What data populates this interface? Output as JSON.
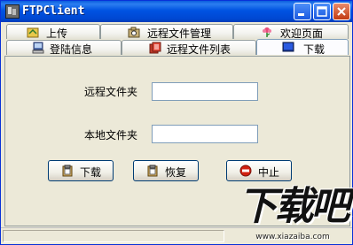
{
  "window": {
    "title": "FTPClient"
  },
  "tabs_top": [
    {
      "label": "上传",
      "icon": "upload-folder-icon"
    },
    {
      "label": "远程文件管理",
      "icon": "camera-icon"
    },
    {
      "label": "欢迎页面",
      "icon": "flower-icon"
    }
  ],
  "tabs_bottom": [
    {
      "label": "登陆信息",
      "icon": "computer-icon"
    },
    {
      "label": "远程文件列表",
      "icon": "folder-list-icon"
    },
    {
      "label": "下载",
      "icon": "monitor-icon",
      "active": true
    }
  ],
  "form": {
    "remote_folder_label": "远程文件夹",
    "remote_folder_value": "",
    "local_folder_label": "本地文件夹",
    "local_folder_value": ""
  },
  "actions": {
    "download_label": "下载",
    "restore_label": "恢复",
    "stop_label": "中止"
  },
  "watermark": {
    "logo_text": "下载吧",
    "url": "www.xiazaiba.com"
  },
  "colors": {
    "titlebar": "#0053e2",
    "stop_icon": "#d22010",
    "dialog_bg": "#ece9d8"
  }
}
